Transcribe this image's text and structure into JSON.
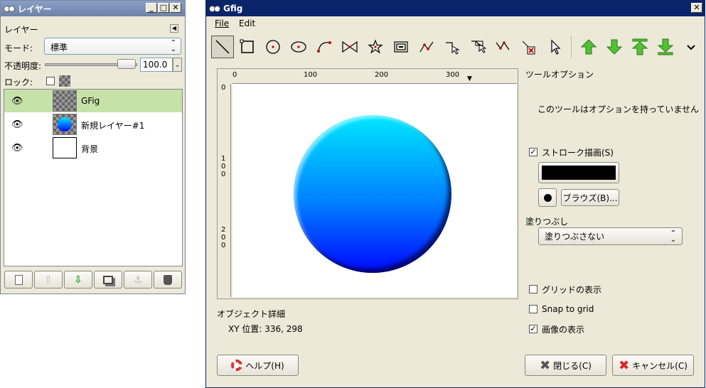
{
  "layers": {
    "title": "レイヤー",
    "header_label": "レイヤー",
    "mode_label": "モード:",
    "mode_value": "標準",
    "opacity_label": "不透明度:",
    "opacity_value": "100.0",
    "lock_label": "ロック:",
    "items": [
      {
        "name": "GFig",
        "selected": true
      },
      {
        "name": "新規レイヤー#1",
        "selected": false
      },
      {
        "name": "背景",
        "selected": false
      }
    ]
  },
  "gfig": {
    "title": "Gfig",
    "menu": {
      "file": "File",
      "edit": "Edit"
    },
    "tools": [
      "line-tool-icon",
      "rectangle-tool-icon",
      "circle-tool-icon",
      "ellipse-tool-icon",
      "arc-tool-icon",
      "polygon-tool-icon",
      "star-tool-icon",
      "spiral-tool-icon",
      "bezier-tool-icon",
      "move-object-icon",
      "move-point-icon",
      "copy-object-icon",
      "delete-object-icon",
      "select-object-icon",
      "raise-object-icon",
      "lower-object-icon",
      "raise-top-icon",
      "lower-bottom-icon",
      "more-icon"
    ],
    "ruler_h_ticks": [
      "0",
      "100",
      "200",
      "300"
    ],
    "ruler_v_ticks": [
      "0",
      "1\n0\n0",
      "2\n0\n0"
    ],
    "object_details_label": "オブジェクト詳細",
    "xy_label": "XY 位置: 336, 298",
    "tool_options_label": "ツールオプション",
    "no_options_text": "このツールはオプションを持っていません",
    "stroke_label": "ストローク描画(S)",
    "browse_label": "ブラウズ(B)...",
    "fill_label": "塗りつぶし",
    "fill_value": "塗りつぶさない",
    "show_grid_label": "グリッドの表示",
    "snap_grid_label": "Snap to grid",
    "show_image_label": "画像の表示",
    "help_label": "ヘルプ(H)",
    "close_label": "閉じる(C)",
    "cancel_label": "キャンセル(C)",
    "stroke_color": "#000000",
    "circle_top_color": "#00e8ff",
    "circle_bottom_color": "#0008ff"
  }
}
